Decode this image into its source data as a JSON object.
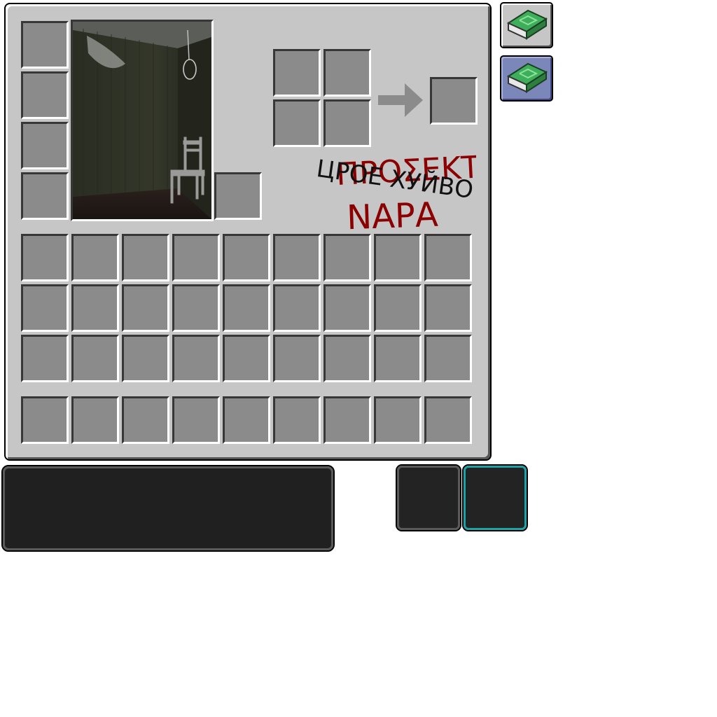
{
  "scribble": {
    "red_text": "ΠΡΟΣΕΚΤ",
    "red_text_2": "ΝΑΡΑ",
    "black_text": "ЦРОЕ ХУЙВО"
  },
  "icons": {
    "book_tab_1": "enchanted-book-icon",
    "book_tab_2": "enchanted-book-icon",
    "arrow": "crafting-arrow-icon"
  },
  "colors": {
    "panel": "#c6c6c6",
    "slot": "#8b8b8b",
    "scribble_red": "#8b0000",
    "scribble_black": "#111111",
    "selected_outline": "#1aa3a8",
    "book_green": "#3fae5a"
  }
}
